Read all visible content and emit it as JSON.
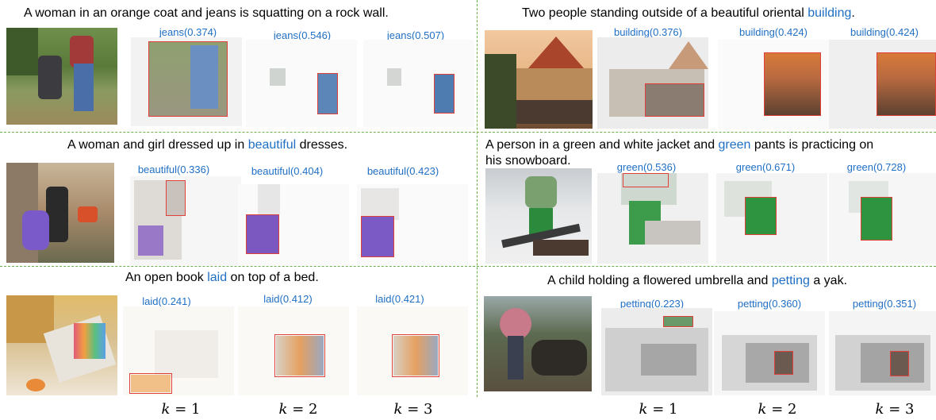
{
  "rows": [
    {
      "caption_left": {
        "pre": "A woman in an orange coat and jeans is squatting on a rock wall.",
        "word": "",
        "post": ""
      },
      "labels_left": [
        "jeans(0.374)",
        "jeans(0.546)",
        "jeans(0.507)"
      ],
      "caption_right": {
        "pre": "Two people standing outside of a beautiful oriental ",
        "word": "building",
        "post": "."
      },
      "labels_right": [
        "building(0.376)",
        "building(0.424)",
        "building(0.424)"
      ]
    },
    {
      "caption_left": {
        "pre": "A woman and girl dressed up in ",
        "word": "beautiful",
        "post": " dresses."
      },
      "labels_left": [
        "beautiful(0.336)",
        "beautiful(0.404)",
        "beautiful(0.423)"
      ],
      "caption_right": {
        "pre": "A person in a green and white jacket and ",
        "word": "green",
        "post": " pants is practicing on"
      },
      "caption_right_line2": "his snowboard.",
      "labels_right": [
        "green(0.536)",
        "green(0.671)",
        "green(0.728)"
      ]
    },
    {
      "caption_left": {
        "pre": "An open book ",
        "word": "laid",
        "post": " on top of a bed."
      },
      "labels_left": [
        "laid(0.241)",
        "laid(0.412)",
        "laid(0.421)"
      ],
      "caption_right": {
        "pre": "A child holding a flowered umbrella and ",
        "word": "petting",
        "post": " a yak."
      },
      "labels_right": [
        "petting(0.223)",
        "petting(0.360)",
        "petting(0.351)"
      ]
    }
  ],
  "k_labels": {
    "var": "k",
    "eq": " = ",
    "values": [
      "1",
      "2",
      "3"
    ]
  },
  "colors": {
    "highlight": "#1f6fc5",
    "box": "#e0403a",
    "separator": "#6ab04c"
  }
}
